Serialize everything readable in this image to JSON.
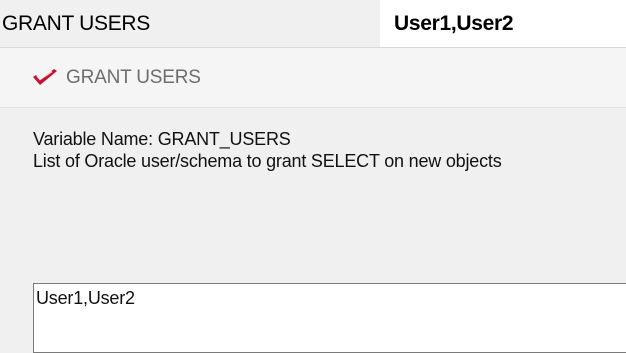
{
  "property_row": {
    "name": "GRANT USERS",
    "value": "User1,User2"
  },
  "help_panel": {
    "header_icon": "red-check-icon",
    "title": "GRANT USERS",
    "variable_line": "Variable Name: GRANT_USERS",
    "description": "List of Oracle user/schema to grant SELECT on new objects",
    "value_field": "User1,User2"
  },
  "colors": {
    "icon_red": "#c8102e",
    "title_gray": "#6d6d6d",
    "panel_bg": "#f0f0f0",
    "field_border": "#7a7a7a"
  }
}
